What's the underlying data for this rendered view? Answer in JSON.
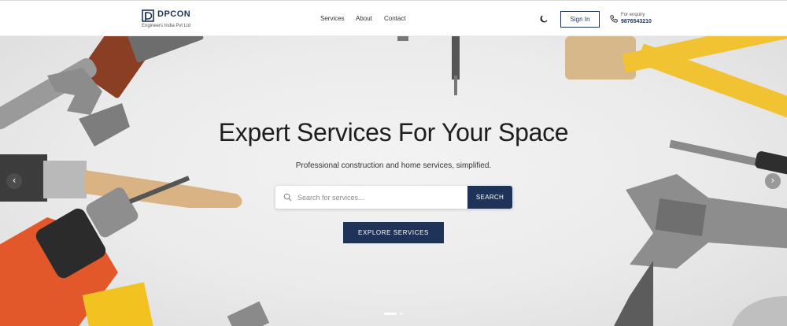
{
  "brand": {
    "name": "DPCON",
    "tagline": "Engineers India Pvt Ltd",
    "color": "#1f3358"
  },
  "nav": {
    "items": [
      {
        "label": "Services"
      },
      {
        "label": "About"
      },
      {
        "label": "Contact"
      }
    ]
  },
  "header": {
    "theme_icon": "moon-icon",
    "signin_label": "Sign In",
    "enquiry_label": "For enquiry",
    "enquiry_number": "9876543210"
  },
  "hero": {
    "title": "Expert Services For Your Space",
    "subtitle": "Professional construction and home services, simplified.",
    "search_placeholder": "Search for services...",
    "search_button": "SEARCH",
    "explore_button": "EXPLORE SERVICES",
    "prev_arrow": "‹",
    "next_arrow": "›",
    "slides_total": 2,
    "active_slide": 1
  }
}
